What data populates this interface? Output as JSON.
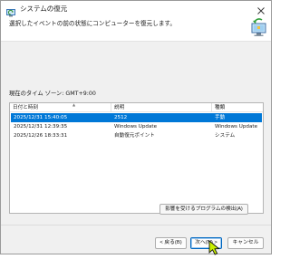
{
  "window": {
    "title": "システムの復元"
  },
  "header": {
    "instruction": "選択したイベントの前の状態にコンピューターを復元します。"
  },
  "timezone_label": "現在のタイム ゾーン: GMT+9:00",
  "table": {
    "columns": [
      "日付と時刻",
      "説明",
      "種類"
    ],
    "rows": [
      {
        "datetime": "2025/12/31 15:40:05",
        "description": "2512",
        "type": "手動",
        "selected": true
      },
      {
        "datetime": "2025/12/31 12:39:35",
        "description": "Windows Update",
        "type": "Windows Update",
        "selected": false
      },
      {
        "datetime": "2025/12/26 18:33:31",
        "description": "自動復元ポイント",
        "type": "システム",
        "selected": false
      }
    ]
  },
  "buttons": {
    "scan_affected": "影響を受けるプログラムの検出(A)",
    "back": "< 戻る(B)",
    "next": "次へ(N) >",
    "cancel": "キャンセル"
  },
  "icons": {
    "title": "system-restore-icon",
    "header": "computer-restore-icon",
    "close": "close-icon",
    "cursor": "mouse-pointer-icon"
  },
  "colors": {
    "selection": "#0078d7",
    "default_button_border": "#0067c0"
  }
}
